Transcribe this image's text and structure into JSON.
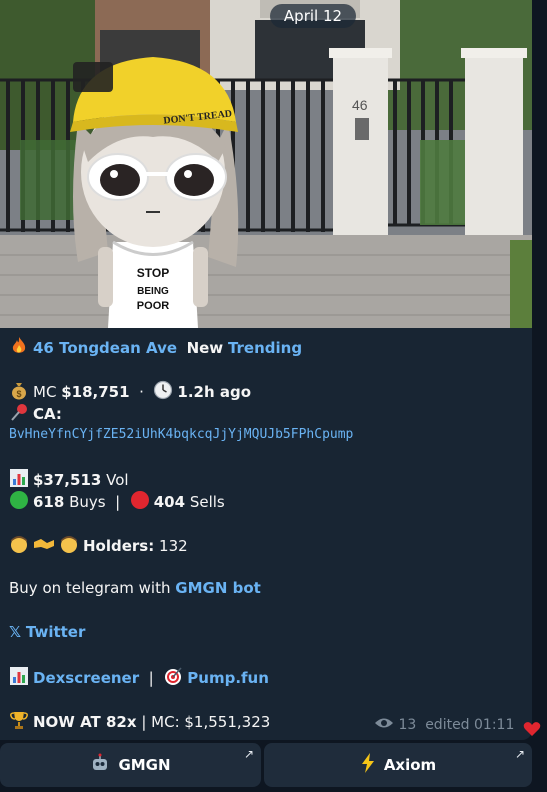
{
  "date": "April 12",
  "title": {
    "name": "46 Tongdean Ave",
    "new_label": "New",
    "trending": "Trending"
  },
  "mc": {
    "label": "MC",
    "value": "$18,751",
    "sep": "·",
    "age": "1.2h ago"
  },
  "ca": {
    "label": "CA:",
    "address": "BvHneYfnCYjfZE52iUhK4bqkcqJjYjMQUJb5FPhCpump"
  },
  "volume": {
    "value": "$37,513",
    "label": "Vol"
  },
  "trades": {
    "buys_count": "618",
    "buys_label": "Buys",
    "sep": "|",
    "sells_count": "404",
    "sells_label": "Sells"
  },
  "holders": {
    "label": "Holders:",
    "count": "132"
  },
  "buy_line": {
    "prefix": "Buy on telegram with",
    "link": "GMGN bot"
  },
  "twitter": {
    "icon_text": "𝕏",
    "label": "Twitter"
  },
  "links": {
    "dexscreener": "Dexscreener",
    "sep": "|",
    "pumpfun": "Pump.fun"
  },
  "now_at": {
    "label": "NOW AT 82x",
    "sep": "|",
    "mc": "MC: $1,551,323"
  },
  "meta": {
    "views": "13",
    "edited": "edited 01:11"
  },
  "buttons": {
    "gmgn": "GMGN",
    "axiom": "Axiom",
    "arrow": "↗"
  },
  "sticker": {
    "cap_text": "DON'T TREAD",
    "gate_number": "46",
    "shirt_text": "STOP\nBEING\nPOOR"
  },
  "colors": {
    "link": "#6ab3f3",
    "bubble": "#182533",
    "background": "#0e1621",
    "button": "#1f2c3b"
  },
  "icons": [
    "fire-icon",
    "money-bag-icon",
    "clock-icon",
    "pushpin-icon",
    "chart-icon",
    "green-circle-icon",
    "red-circle-icon",
    "person-icon",
    "handshake-icon",
    "x-logo-icon",
    "target-icon",
    "trophy-icon",
    "eye-icon",
    "heart-icon",
    "robot-icon",
    "lightning-icon"
  ]
}
